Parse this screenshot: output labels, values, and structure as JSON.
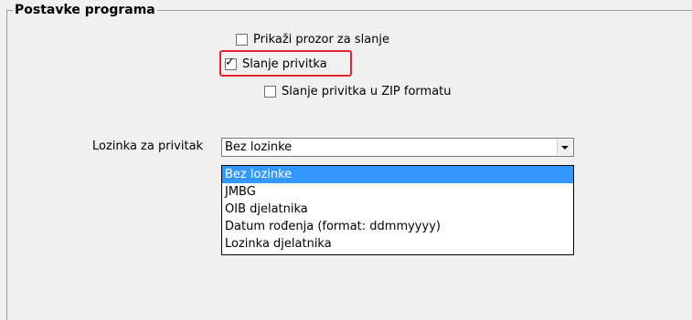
{
  "group": {
    "title": "Postavke programa"
  },
  "options": {
    "show_window": {
      "label": "Prikaži prozor za slanje",
      "checked": false
    },
    "send_attachment": {
      "label": "Slanje privitka",
      "checked": true
    },
    "send_zip": {
      "label": "Slanje privitka u ZIP formatu",
      "checked": false
    }
  },
  "password": {
    "label": "Lozinka za privitak",
    "value": "Bez lozinke",
    "options": [
      "Bez lozinke",
      "JMBG",
      "OIB djelatnika",
      "Datum rođenja (format: ddmmyyyy)",
      "Lozinka djelatnika"
    ],
    "selected_index": 0
  },
  "colors": {
    "highlight_border": "#e3232e",
    "selection": "#3399ff"
  }
}
